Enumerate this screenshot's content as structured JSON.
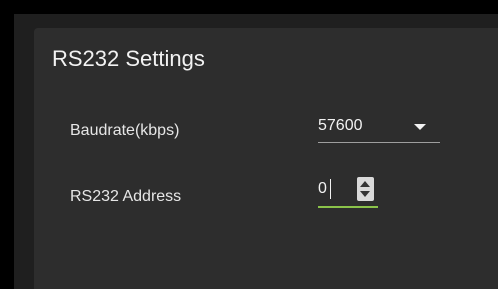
{
  "panel": {
    "title": "RS232 Settings"
  },
  "baudrate": {
    "label": "Baudrate(kbps)",
    "selected": "57600",
    "icon": "chevron-down-icon"
  },
  "address": {
    "label": "RS232 Address",
    "value": "0",
    "spinner_icon": "spinner-arrows-icon",
    "focus_color": "#8bc34a"
  }
}
